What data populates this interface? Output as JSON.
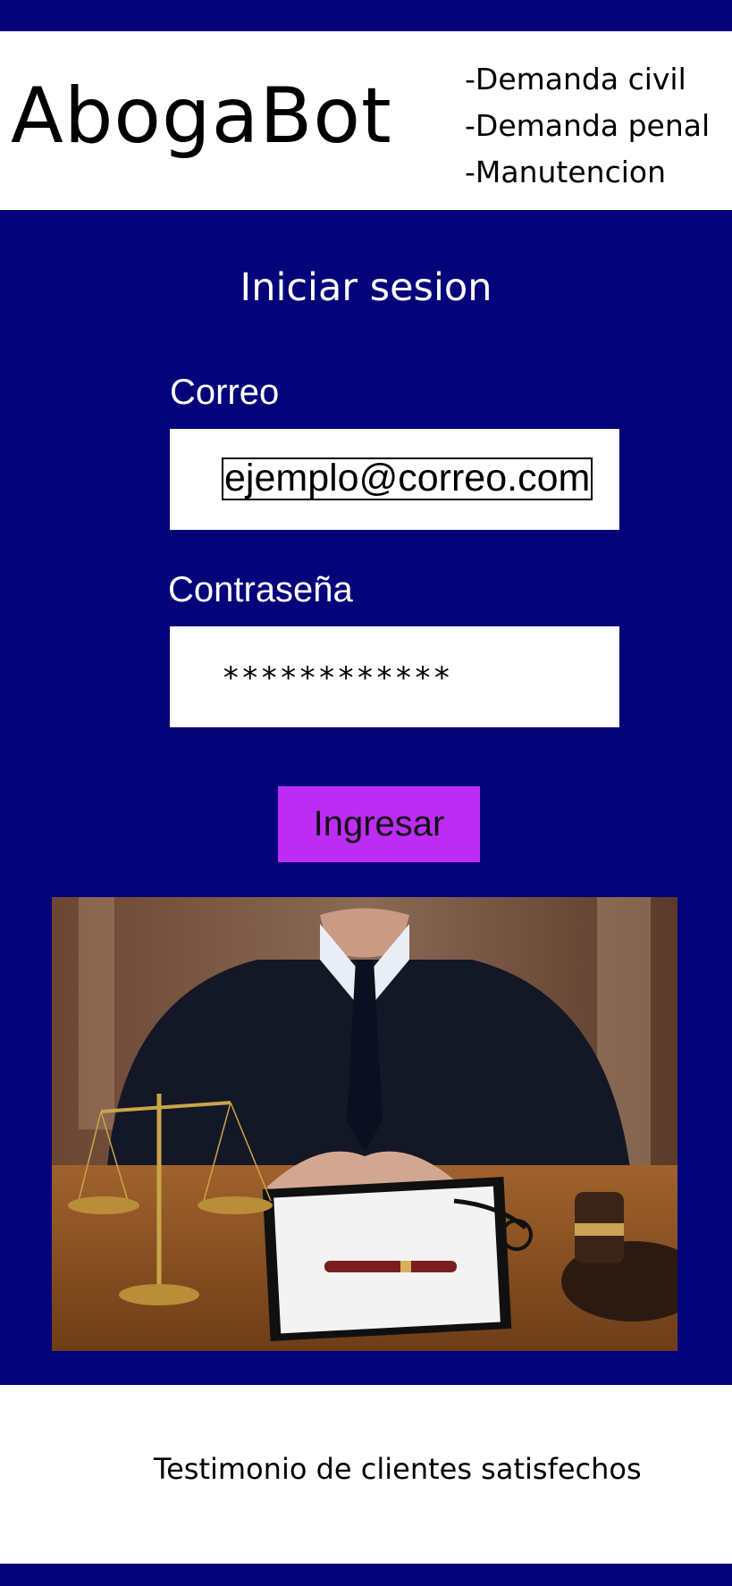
{
  "header": {
    "logo": "AbogaBot",
    "services": [
      "-Demanda civil",
      "-Demanda penal",
      "-Manutencion"
    ]
  },
  "login": {
    "title": "Iniciar sesion",
    "email_label": "Correo",
    "email_value": "ejemplo@correo.com",
    "password_label": "Contraseña",
    "password_value": "************",
    "submit_label": "Ingresar"
  },
  "image": {
    "subject": "lawyer-at-desk-photo"
  },
  "footer": {
    "testimonials": "Testimonio de clientes satisfechos"
  },
  "colors": {
    "background": "#05037a",
    "button": "#bd2cf5",
    "surface": "#ffffff"
  }
}
